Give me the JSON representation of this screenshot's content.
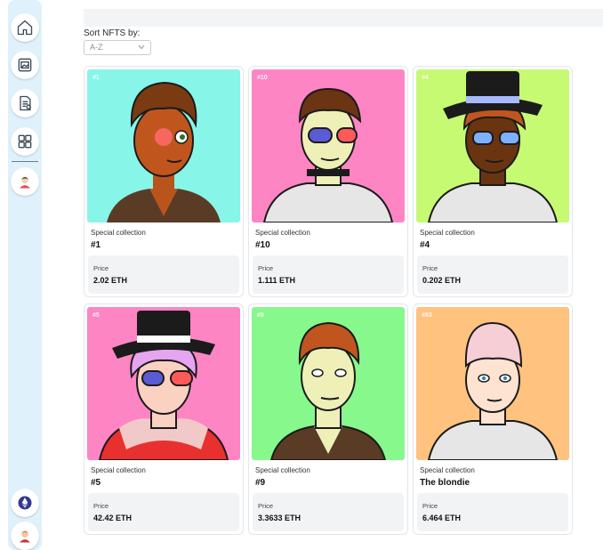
{
  "sidebar": {
    "items": [
      {
        "name": "home",
        "icon": "home-icon"
      },
      {
        "name": "gallery",
        "icon": "image-frame-icon"
      },
      {
        "name": "document",
        "icon": "document-icon"
      },
      {
        "name": "collections",
        "icon": "grid-icon"
      },
      {
        "name": "profile",
        "icon": "avatar-icon"
      }
    ],
    "bottom": [
      {
        "name": "ethereum",
        "icon": "ethereum-icon"
      },
      {
        "name": "user",
        "icon": "avatar-icon"
      }
    ]
  },
  "sort": {
    "label": "Sort NFTS by:",
    "selected": "A-Z"
  },
  "nfts": [
    {
      "badge": "#1",
      "collection": "Special collection",
      "name": "#1",
      "price_label": "Price",
      "price": "2.02 ETH",
      "bg": "#87f5e8"
    },
    {
      "badge": "#10",
      "collection": "Special collection",
      "name": "#10",
      "price_label": "Price",
      "price": "1.111 ETH",
      "bg": "#fd85c4"
    },
    {
      "badge": "#4",
      "collection": "Special collection",
      "name": "#4",
      "price_label": "Price",
      "price": "0.202 ETH",
      "bg": "#c6fa73"
    },
    {
      "badge": "#5",
      "collection": "Special collection",
      "name": "#5",
      "price_label": "Price",
      "price": "42.42 ETH",
      "bg": "#fd85c4"
    },
    {
      "badge": "#9",
      "collection": "Special collection",
      "name": "#9",
      "price_label": "Price",
      "price": "3.3633 ETH",
      "bg": "#86f88c"
    },
    {
      "badge": "#83",
      "collection": "Special collection",
      "name": "The blondie",
      "price_label": "Price",
      "price": "6.464 ETH",
      "bg": "#ffc27f"
    }
  ],
  "colors": {
    "sidebar_bg": "#dff1fb",
    "icon_stroke": "#3b4a57",
    "ethereum_bg": "#2f3a8f"
  }
}
